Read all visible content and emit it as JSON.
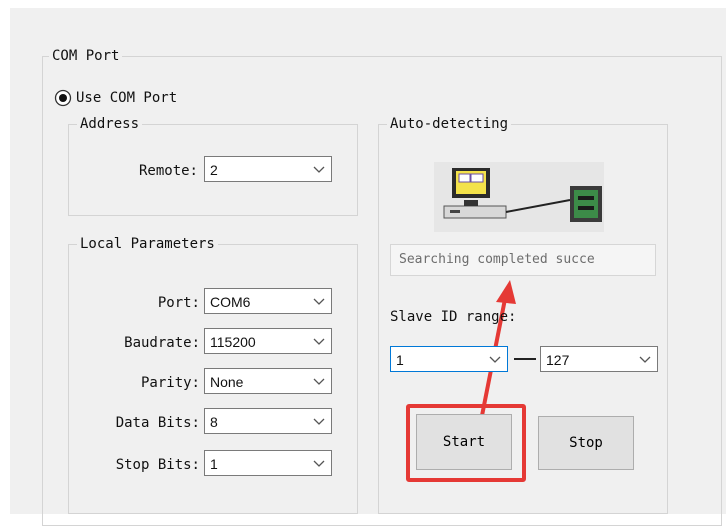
{
  "com_port": {
    "title": "COM Port",
    "use_com_port_label": "Use COM Port",
    "address": {
      "title": "Address",
      "remote_label": "Remote:",
      "remote_value": "2"
    },
    "local_parameters": {
      "title": "Local Parameters",
      "fields": [
        {
          "label": "Port:",
          "value": "COM6"
        },
        {
          "label": "Baudrate:",
          "value": "115200"
        },
        {
          "label": "Parity:",
          "value": "None"
        },
        {
          "label": "Data Bits:",
          "value": "8"
        },
        {
          "label": "Stop Bits:",
          "value": "1"
        }
      ]
    },
    "auto_detecting": {
      "title": "Auto-detecting",
      "status_text": "Searching completed succe",
      "slave_id_label": "Slave ID range:",
      "range_from": "1",
      "range_to": "127",
      "start_label": "Start",
      "stop_label": "Stop"
    }
  },
  "colors": {
    "panel_bg": "#f0f0f0",
    "highlight_red": "#e53935",
    "focus_blue": "#0078d7"
  },
  "icons": [
    "chevron-down-icon",
    "radio-selected-icon",
    "computer-device-icon",
    "arrow-pointer-icon"
  ]
}
